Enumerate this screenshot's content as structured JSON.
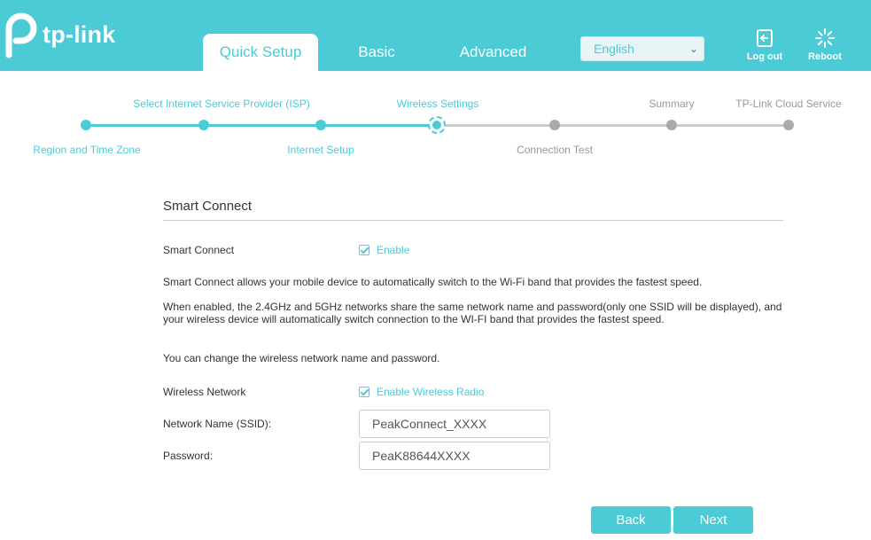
{
  "header": {
    "logo_text": "tp-link",
    "tabs": [
      {
        "label": "Quick Setup"
      },
      {
        "label": "Basic"
      },
      {
        "label": "Advanced"
      }
    ],
    "language": {
      "selected": "English"
    },
    "logout_label": "Log out",
    "reboot_label": "Reboot"
  },
  "progress": {
    "steps": [
      {
        "label": "Region and Time Zone",
        "state": "done"
      },
      {
        "label": "Select Internet Service Provider (ISP)",
        "state": "done"
      },
      {
        "label": "Internet Setup",
        "state": "done"
      },
      {
        "label": "Wireless Settings",
        "state": "current"
      },
      {
        "label": "Connection Test",
        "state": "todo"
      },
      {
        "label": "Summary",
        "state": "todo"
      },
      {
        "label": "TP-Link Cloud Service",
        "state": "todo"
      }
    ]
  },
  "form": {
    "section_title": "Smart Connect",
    "smart_connect_label": "Smart Connect",
    "smart_connect_checkbox": "Enable",
    "smart_connect_checked": true,
    "desc1": "Smart Connect allows your mobile device to automatically switch to the Wi-Fi band that provides the fastest speed.",
    "desc2": "When enabled, the 2.4GHz and 5GHz networks share the same network name and password(only one SSID will be displayed), and your wireless device will automatically switch connection to the WI-FI band that provides the fastest speed.",
    "desc3": "You can change the wireless network name and password.",
    "wireless_network_label": "Wireless Network",
    "wireless_radio_checkbox": "Enable Wireless Radio",
    "wireless_radio_checked": true,
    "ssid_label": "Network Name (SSID):",
    "ssid_value": "PeakConnect_XXXX",
    "password_label": "Password:",
    "password_value": "PeaK88644XXXX"
  },
  "buttons": {
    "back": "Back",
    "next": "Next"
  },
  "colors": {
    "accent": "#4acbd6",
    "inactive_step": "#aaaaaa"
  }
}
